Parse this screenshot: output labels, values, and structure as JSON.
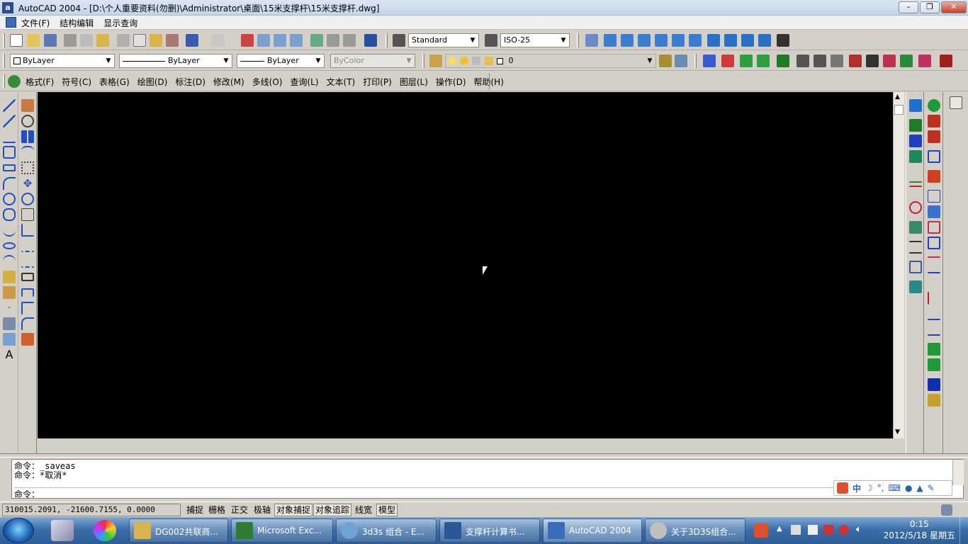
{
  "window": {
    "title": "AutoCAD 2004 - [D:\\个人重要资料(勿删)\\Administrator\\桌面\\15米支撑杆\\15米支撑杆.dwg]",
    "app_icon_letter": "a",
    "controls": {
      "minimize": "–",
      "restore": "❐",
      "close": "✕"
    }
  },
  "menubar": {
    "items": [
      "文件(F)",
      "结构编辑",
      "显示查询"
    ]
  },
  "styles_toolbar": {
    "text_style": "Standard",
    "dim_style": "ISO-25"
  },
  "properties_toolbar": {
    "color": "ByLayer",
    "linetype": "ByLayer",
    "lineweight": "ByLayer",
    "plotstyle": "ByColor",
    "layer": "0"
  },
  "custom_menu": {
    "items": [
      "格式(F)",
      "符号(C)",
      "表格(G)",
      "绘图(D)",
      "标注(D)",
      "修改(M)",
      "多线(O)",
      "查询(L)",
      "文本(T)",
      "打印(P)",
      "图层(L)",
      "操作(D)",
      "帮助(H)"
    ]
  },
  "command_area": {
    "line1_prompt": "命令：",
    "line1_text": "_saveas",
    "line2_prompt": "命令：",
    "line2_text": "*取消*",
    "line3_prompt": "命令："
  },
  "ime": {
    "lang": "中"
  },
  "statusbar": {
    "coords": "310015.2091, -21600.7155, 0.0000",
    "buttons": [
      "捕捉",
      "栅格",
      "正交",
      "极轴",
      "对象捕捉",
      "对象追踪",
      "线宽",
      "模型"
    ],
    "on_states": [
      false,
      false,
      false,
      false,
      true,
      true,
      false,
      true
    ]
  },
  "taskbar": {
    "tasks": [
      {
        "label": "DG002共联商...",
        "icon": "folder-icon",
        "color": "#d9b44a"
      },
      {
        "label": "Microsoft Exc...",
        "icon": "excel-icon",
        "color": "#2f7d32"
      },
      {
        "label": "3d3s 组合 - E...",
        "icon": "search-doc-icon",
        "color": "#6fa3d8"
      },
      {
        "label": "支撑杆计算书...",
        "icon": "word-icon",
        "color": "#2b5797"
      },
      {
        "label": "AutoCAD 2004",
        "icon": "autocad-icon",
        "color": "#3a6cb8"
      },
      {
        "label": "关于3D3S组合...",
        "icon": "magnifier-icon",
        "color": "#c0c0c0"
      }
    ],
    "clock_time": "0:15",
    "clock_date": "2012/5/18 星期五"
  },
  "colors": {
    "canvas": "#000000",
    "ui_face": "#d4d0c8",
    "taskbar": "#3c6ea8"
  }
}
